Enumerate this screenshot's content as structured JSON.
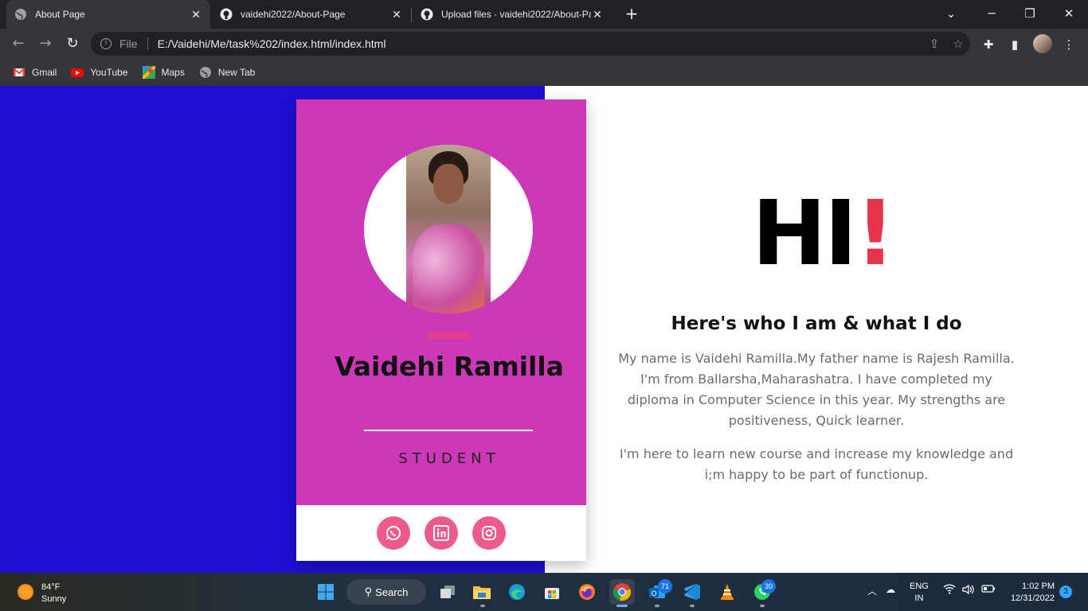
{
  "browser": {
    "tabs": [
      {
        "title": "About Page",
        "active": true
      },
      {
        "title": "vaidehi2022/About-Page",
        "active": false
      },
      {
        "title": "Upload files · vaidehi2022/About-Pa",
        "active": false
      }
    ],
    "new_tab_symbol": "+",
    "address": {
      "scheme_label": "File",
      "url": "E:/Vaidehi/Me/task%202/index.html/index.html"
    },
    "bookmarks": [
      {
        "label": "Gmail",
        "icon": "gmail-icon",
        "color": "#ea4335"
      },
      {
        "label": "YouTube",
        "icon": "youtube-icon",
        "color": "#ff0000"
      },
      {
        "label": "Maps",
        "icon": "maps-icon",
        "color": "#34a853"
      },
      {
        "label": "New Tab",
        "icon": "globe-icon",
        "color": "#9aa0a6"
      }
    ]
  },
  "page": {
    "colors": {
      "left_bg": "#1e0fd2",
      "card_bg": "#cc39b6",
      "accent": "#e6344c",
      "social": "#ee5a8a"
    },
    "card": {
      "name": "Vaidehi Ramilla",
      "role": "STUDENT",
      "socials": [
        {
          "name": "whatsapp",
          "icon": "whatsapp-icon"
        },
        {
          "name": "linkedin",
          "icon": "linkedin-icon"
        },
        {
          "name": "instagram",
          "icon": "instagram-icon"
        }
      ]
    },
    "hero": {
      "hi": "HI",
      "bang": "!"
    },
    "subheading": "Here's who I am & what I do",
    "paragraph1": "My name is Vaidehi Ramilla.My father name is Rajesh Ramilla. I'm from Ballarsha,Maharashatra. I have completed my diploma in Computer Science in this year. My strengths are positiveness, Quick learner.",
    "paragraph2": "I'm here to learn new course and increase my knowledge and i;m happy to be part of functionup."
  },
  "taskbar": {
    "weather": {
      "temp": "84°F",
      "condition": "Sunny"
    },
    "search_label": "Search",
    "badges": {
      "outlook": "71",
      "whatsapp": "30"
    },
    "language": {
      "line1": "ENG",
      "line2": "IN"
    },
    "clock": {
      "time": "1:02 PM",
      "date": "12/31/2022"
    },
    "notifications": "3"
  }
}
